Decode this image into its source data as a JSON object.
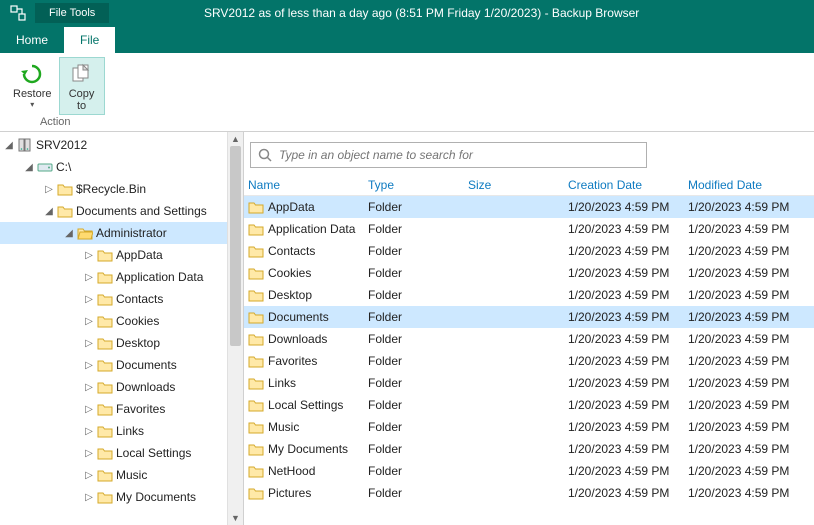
{
  "titlebar": {
    "tool_tab": "File Tools",
    "title": "SRV2012 as of less than a day ago (8:51 PM Friday 1/20/2023) - Backup Browser"
  },
  "tabs": {
    "home": "Home",
    "file": "File"
  },
  "ribbon": {
    "restore": "Restore",
    "copy_to_l1": "Copy",
    "copy_to_l2": "to",
    "group": "Action"
  },
  "search": {
    "placeholder": "Type in an object name to search for"
  },
  "tree": {
    "root": "SRV2012",
    "drive": "C:\\",
    "recycle": "$Recycle.Bin",
    "docs_settings": "Documents and Settings",
    "admin": "Administrator",
    "items": [
      "AppData",
      "Application Data",
      "Contacts",
      "Cookies",
      "Desktop",
      "Documents",
      "Downloads",
      "Favorites",
      "Links",
      "Local Settings",
      "Music",
      "My Documents"
    ]
  },
  "columns": {
    "name": "Name",
    "type": "Type",
    "size": "Size",
    "cdate": "Creation Date",
    "mdate": "Modified Date"
  },
  "rows": [
    {
      "name": "AppData",
      "type": "Folder",
      "size": "",
      "cdate": "1/20/2023 4:59 PM",
      "mdate": "1/20/2023 4:59 PM",
      "sel": true
    },
    {
      "name": "Application Data",
      "type": "Folder",
      "size": "",
      "cdate": "1/20/2023 4:59 PM",
      "mdate": "1/20/2023 4:59 PM"
    },
    {
      "name": "Contacts",
      "type": "Folder",
      "size": "",
      "cdate": "1/20/2023 4:59 PM",
      "mdate": "1/20/2023 4:59 PM"
    },
    {
      "name": "Cookies",
      "type": "Folder",
      "size": "",
      "cdate": "1/20/2023 4:59 PM",
      "mdate": "1/20/2023 4:59 PM"
    },
    {
      "name": "Desktop",
      "type": "Folder",
      "size": "",
      "cdate": "1/20/2023 4:59 PM",
      "mdate": "1/20/2023 4:59 PM"
    },
    {
      "name": "Documents",
      "type": "Folder",
      "size": "",
      "cdate": "1/20/2023 4:59 PM",
      "mdate": "1/20/2023 4:59 PM",
      "sel": true
    },
    {
      "name": "Downloads",
      "type": "Folder",
      "size": "",
      "cdate": "1/20/2023 4:59 PM",
      "mdate": "1/20/2023 4:59 PM"
    },
    {
      "name": "Favorites",
      "type": "Folder",
      "size": "",
      "cdate": "1/20/2023 4:59 PM",
      "mdate": "1/20/2023 4:59 PM"
    },
    {
      "name": "Links",
      "type": "Folder",
      "size": "",
      "cdate": "1/20/2023 4:59 PM",
      "mdate": "1/20/2023 4:59 PM"
    },
    {
      "name": "Local Settings",
      "type": "Folder",
      "size": "",
      "cdate": "1/20/2023 4:59 PM",
      "mdate": "1/20/2023 4:59 PM"
    },
    {
      "name": "Music",
      "type": "Folder",
      "size": "",
      "cdate": "1/20/2023 4:59 PM",
      "mdate": "1/20/2023 4:59 PM"
    },
    {
      "name": "My Documents",
      "type": "Folder",
      "size": "",
      "cdate": "1/20/2023 4:59 PM",
      "mdate": "1/20/2023 4:59 PM"
    },
    {
      "name": "NetHood",
      "type": "Folder",
      "size": "",
      "cdate": "1/20/2023 4:59 PM",
      "mdate": "1/20/2023 4:59 PM"
    },
    {
      "name": "Pictures",
      "type": "Folder",
      "size": "",
      "cdate": "1/20/2023 4:59 PM",
      "mdate": "1/20/2023 4:59 PM"
    }
  ]
}
